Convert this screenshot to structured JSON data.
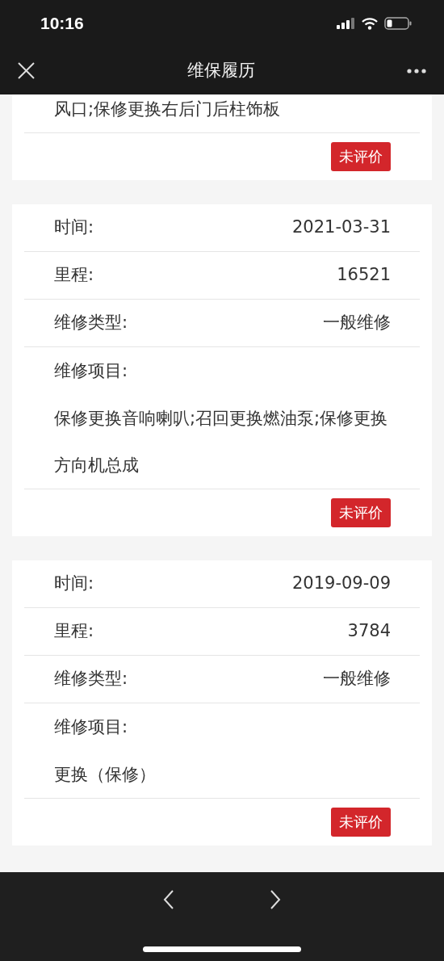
{
  "status_bar": {
    "time": "10:16"
  },
  "header": {
    "title": "维保履历"
  },
  "records": [
    {
      "rows": [
        {
          "kind": "text",
          "text": "风口;保修更换右后门后柱饰板"
        }
      ],
      "badge": "未评价"
    },
    {
      "rows": [
        {
          "kind": "field",
          "label": "时间:",
          "value": "2021-03-31"
        },
        {
          "kind": "field",
          "label": "里程:",
          "value": "16521"
        },
        {
          "kind": "field",
          "label": "维修类型:",
          "value": "一般维修"
        },
        {
          "kind": "heading",
          "label": "维修项目:"
        },
        {
          "kind": "text",
          "text": "保修更换音响喇叭;召回更换燃油泵;保修更换方向机总成"
        }
      ],
      "badge": "未评价"
    },
    {
      "rows": [
        {
          "kind": "field",
          "label": "时间:",
          "value": "2019-09-09"
        },
        {
          "kind": "field",
          "label": "里程:",
          "value": "3784"
        },
        {
          "kind": "field",
          "label": "维修类型:",
          "value": "一般维修"
        },
        {
          "kind": "heading",
          "label": "维修项目:"
        },
        {
          "kind": "text",
          "text": "更换（保修）"
        }
      ],
      "badge": "未评价"
    }
  ]
}
